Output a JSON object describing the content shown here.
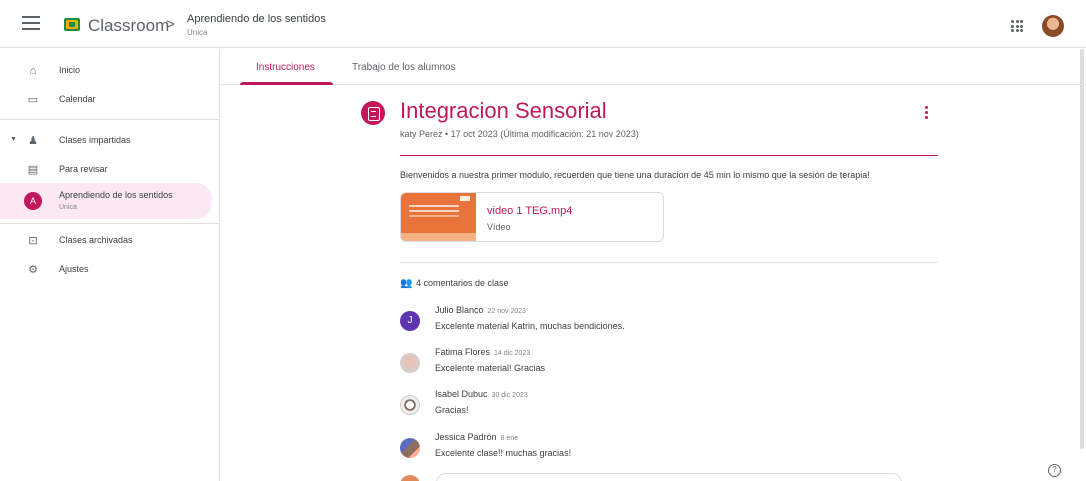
{
  "header": {
    "app_title": "Classroom",
    "breadcrumb_sep": ">",
    "class_name": "Aprendiendo de los sentidos",
    "class_section": "Unica",
    "menu_icon": "hamburger-menu-icon",
    "apps_icon": "apps-grid-icon"
  },
  "sidebar": {
    "items": [
      {
        "label": "Inicio",
        "icon": "home-icon"
      },
      {
        "label": "Calendar",
        "icon": "calendar-icon"
      },
      {
        "label": "Clases impartidas",
        "icon": "people-icon"
      },
      {
        "label": "Para revisar",
        "icon": "folder-check-icon"
      },
      {
        "label": "Aprendiendo de los sentidos",
        "sub": "Unica",
        "avatar_letter": "A"
      },
      {
        "label": "Clases archivadas",
        "icon": "archive-icon"
      },
      {
        "label": "Ajustes",
        "icon": "gear-icon"
      }
    ]
  },
  "tabs": [
    {
      "label": "Instrucciones",
      "active": true
    },
    {
      "label": "Trabajo de los alumnos",
      "active": false
    }
  ],
  "post": {
    "title": "Integracion Sensorial",
    "meta": "katy Perez • 17 oct 2023 (Última modificación: 21 nov 2023)",
    "body": "Bienvenidos a nuestra primer modulo, recuerden que tiene una duracion de 45 min lo mismo que la sesión de terapia!",
    "attachment": {
      "name": "video 1 TEG.mp4",
      "type": "Vídeo"
    },
    "accent_color": "#c2185b"
  },
  "comments": {
    "count_label": "4 comentarios de clase",
    "items": [
      {
        "author": "Julio Blanco",
        "date": "22 nov 2023",
        "text": "Excelente material Katrin, muchas bendiciones.",
        "avatar_letter": "J"
      },
      {
        "author": "Fatima Flores",
        "date": "14 dic 2023",
        "text": "Excelente material! Gracias"
      },
      {
        "author": "Isabel Dubuc",
        "date": "30 dic 2023",
        "text": "Gracias!"
      },
      {
        "author": "Jessica Padrón",
        "date": "8 ene",
        "text": "Excelente clase!! muchas gracias!"
      }
    ]
  },
  "help_glyph": "?"
}
